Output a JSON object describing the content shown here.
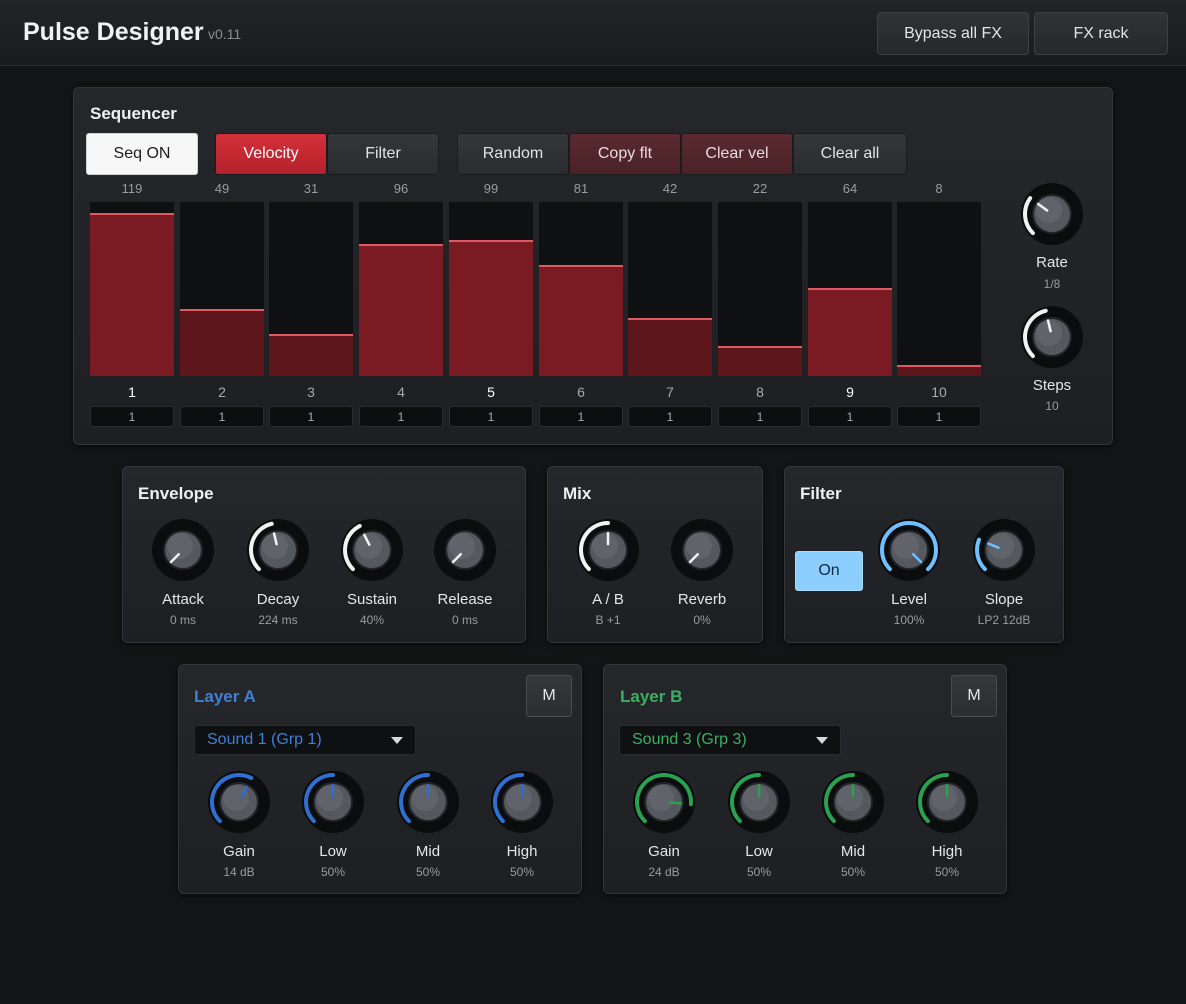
{
  "app": {
    "title": "Pulse Designer",
    "version": "v0.11"
  },
  "header": {
    "bypass_label": "Bypass all FX",
    "fx_rack_label": "FX rack"
  },
  "sequencer": {
    "title": "Sequencer",
    "seq_on_label": "Seq ON",
    "velocity_label": "Velocity",
    "filter_label": "Filter",
    "random_label": "Random",
    "copy_flt_label": "Copy flt",
    "clear_vel_label": "Clear vel",
    "clear_all_label": "Clear all",
    "steps": [
      {
        "number": "1",
        "value": "119",
        "velocity": 119,
        "field": "1",
        "accent": true
      },
      {
        "number": "2",
        "value": "49",
        "velocity": 49,
        "field": "1",
        "accent": false
      },
      {
        "number": "3",
        "value": "31",
        "velocity": 31,
        "field": "1",
        "accent": false
      },
      {
        "number": "4",
        "value": "96",
        "velocity": 96,
        "field": "1",
        "accent": false
      },
      {
        "number": "5",
        "value": "99",
        "velocity": 99,
        "field": "1",
        "accent": true
      },
      {
        "number": "6",
        "value": "81",
        "velocity": 81,
        "field": "1",
        "accent": false
      },
      {
        "number": "7",
        "value": "42",
        "velocity": 42,
        "field": "1",
        "accent": false
      },
      {
        "number": "8",
        "value": "22",
        "velocity": 22,
        "field": "1",
        "accent": false
      },
      {
        "number": "9",
        "value": "64",
        "velocity": 64,
        "field": "1",
        "accent": true
      },
      {
        "number": "10",
        "value": "8",
        "velocity": 8,
        "field": "1",
        "accent": false
      }
    ],
    "velocity_max": 127,
    "rate": {
      "label": "Rate",
      "value": "1/8",
      "level": 0.3
    },
    "steps_knob": {
      "label": "Steps",
      "value": "10",
      "level": 0.45
    }
  },
  "envelope": {
    "title": "Envelope",
    "knobs": [
      {
        "label": "Attack",
        "value": "0 ms",
        "level": 0.0
      },
      {
        "label": "Decay",
        "value": "224 ms",
        "level": 0.45
      },
      {
        "label": "Sustain",
        "value": "40%",
        "level": 0.4
      },
      {
        "label": "Release",
        "value": "0 ms",
        "level": 0.0
      }
    ]
  },
  "mix": {
    "title": "Mix",
    "knobs": [
      {
        "label": "A / B",
        "value": "B +1",
        "level": 0.5
      },
      {
        "label": "Reverb",
        "value": "0%",
        "level": 0.0
      }
    ]
  },
  "filter": {
    "title": "Filter",
    "on_label": "On",
    "knobs": [
      {
        "label": "Level",
        "value": "100%",
        "level": 1.0
      },
      {
        "label": "Slope",
        "value": "LP2 12dB",
        "level": 0.25
      }
    ]
  },
  "layer_a": {
    "title": "Layer A",
    "mute_label": "M",
    "sound": "Sound 1 (Grp 1)",
    "knobs": [
      {
        "label": "Gain",
        "value": "14 dB",
        "level": 0.6
      },
      {
        "label": "Low",
        "value": "50%",
        "level": 0.5
      },
      {
        "label": "Mid",
        "value": "50%",
        "level": 0.5
      },
      {
        "label": "High",
        "value": "50%",
        "level": 0.5
      }
    ]
  },
  "layer_b": {
    "title": "Layer B",
    "mute_label": "M",
    "sound": "Sound 3 (Grp 3)",
    "knobs": [
      {
        "label": "Gain",
        "value": "24 dB",
        "level": 0.85
      },
      {
        "label": "Low",
        "value": "50%",
        "level": 0.5
      },
      {
        "label": "Mid",
        "value": "50%",
        "level": 0.5
      },
      {
        "label": "High",
        "value": "50%",
        "level": 0.5
      }
    ]
  },
  "colors": {
    "white_arc": "#f2f2f2",
    "blue_arc": "#2f6fd0",
    "light_blue_arc": "#6fc0ff",
    "green_arc": "#2aa150",
    "layer_a_text": "#3f7fd8",
    "layer_b_text": "#3bb062"
  }
}
